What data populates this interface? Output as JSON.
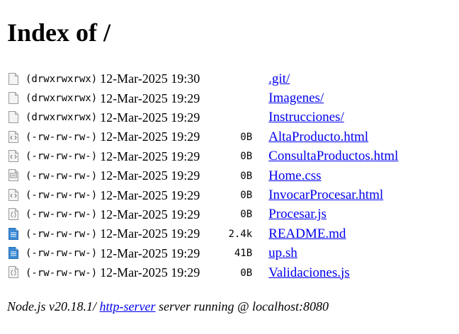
{
  "page_title": "Index of /",
  "entries": [
    {
      "icon": "folder-icon",
      "perm": "(drwxrwxrwx)",
      "date": "12-Mar-2025 19:30",
      "size": "",
      "name": ".git/"
    },
    {
      "icon": "folder-icon",
      "perm": "(drwxrwxrwx)",
      "date": "12-Mar-2025 19:29",
      "size": "",
      "name": "Imagenes/"
    },
    {
      "icon": "folder-icon",
      "perm": "(drwxrwxrwx)",
      "date": "12-Mar-2025 19:29",
      "size": "",
      "name": "Instrucciones/"
    },
    {
      "icon": "html-file-icon",
      "perm": "(-rw-rw-rw-)",
      "date": "12-Mar-2025 19:29",
      "size": "0B",
      "name": "AltaProducto.html"
    },
    {
      "icon": "html-file-icon",
      "perm": "(-rw-rw-rw-)",
      "date": "12-Mar-2025 19:29",
      "size": "0B",
      "name": "ConsultaProductos.html"
    },
    {
      "icon": "css-file-icon",
      "perm": "(-rw-rw-rw-)",
      "date": "12-Mar-2025 19:29",
      "size": "0B",
      "name": "Home.css"
    },
    {
      "icon": "html-file-icon",
      "perm": "(-rw-rw-rw-)",
      "date": "12-Mar-2025 19:29",
      "size": "0B",
      "name": "InvocarProcesar.html"
    },
    {
      "icon": "js-file-icon",
      "perm": "(-rw-rw-rw-)",
      "date": "12-Mar-2025 19:29",
      "size": "0B",
      "name": "Procesar.js"
    },
    {
      "icon": "text-file-icon",
      "perm": "(-rw-rw-rw-)",
      "date": "12-Mar-2025 19:29",
      "size": "2.4k",
      "name": "README.md"
    },
    {
      "icon": "text-file-icon",
      "perm": "(-rw-rw-rw-)",
      "date": "12-Mar-2025 19:29",
      "size": "41B",
      "name": "up.sh"
    },
    {
      "icon": "js-file-icon",
      "perm": "(-rw-rw-rw-)",
      "date": "12-Mar-2025 19:29",
      "size": "0B",
      "name": "Validaciones.js"
    }
  ],
  "footer": {
    "prefix": "Node.js v20.18.1/ ",
    "link_label": "http-server",
    "suffix": " server running @ localhost:8080"
  },
  "colors": {
    "link": "#0000ee",
    "text": "#000000",
    "icon_blue": "#3a8ad6"
  }
}
